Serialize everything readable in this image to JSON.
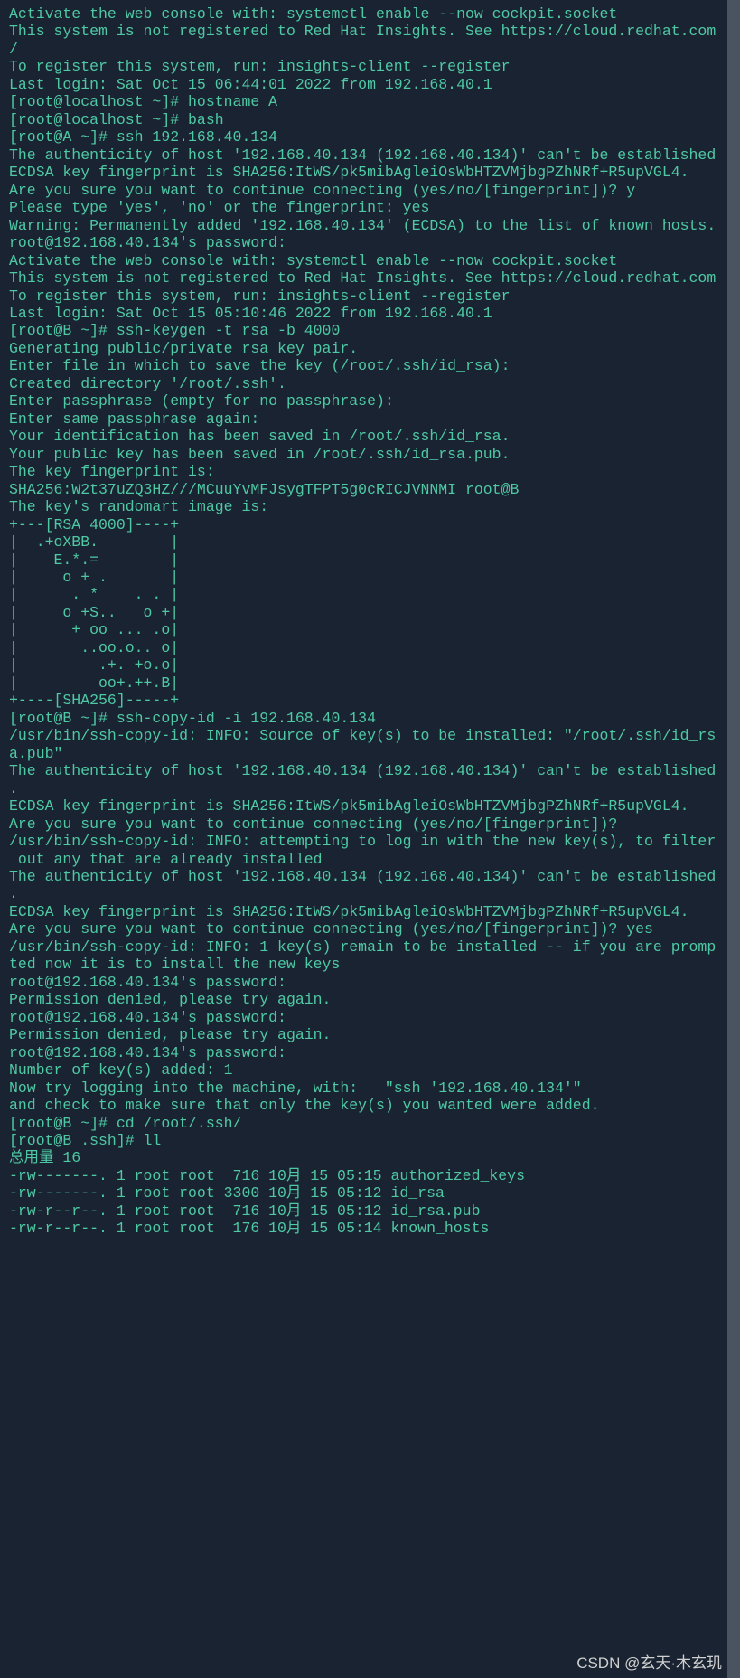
{
  "lines": [
    "Activate the web console with: systemctl enable --now cockpit.socket",
    "",
    "This system is not registered to Red Hat Insights. See https://cloud.redhat.com",
    "/",
    "To register this system, run: insights-client --register",
    "",
    "Last login: Sat Oct 15 06:44:01 2022 from 192.168.40.1",
    "[root@localhost ~]# hostname A",
    "[root@localhost ~]# bash",
    "[root@A ~]# ssh 192.168.40.134",
    "The authenticity of host '192.168.40.134 (192.168.40.134)' can't be established",
    "ECDSA key fingerprint is SHA256:ItWS/pk5mibAgleiOsWbHTZVMjbgPZhNRf+R5upVGL4.",
    "Are you sure you want to continue connecting (yes/no/[fingerprint])? y",
    "Please type 'yes', 'no' or the fingerprint: yes",
    "Warning: Permanently added '192.168.40.134' (ECDSA) to the list of known hosts.",
    "root@192.168.40.134's password:",
    "Activate the web console with: systemctl enable --now cockpit.socket",
    "",
    "This system is not registered to Red Hat Insights. See https://cloud.redhat.com",
    "To register this system, run: insights-client --register",
    "",
    "Last login: Sat Oct 15 05:10:46 2022 from 192.168.40.1",
    "[root@B ~]# ssh-keygen -t rsa -b 4000",
    "Generating public/private rsa key pair.",
    "Enter file in which to save the key (/root/.ssh/id_rsa):",
    "Created directory '/root/.ssh'.",
    "Enter passphrase (empty for no passphrase):",
    "Enter same passphrase again:",
    "Your identification has been saved in /root/.ssh/id_rsa.",
    "Your public key has been saved in /root/.ssh/id_rsa.pub.",
    "The key fingerprint is:",
    "SHA256:W2t37uZQ3HZ///MCuuYvMFJsygTFPT5g0cRICJVNNMI root@B",
    "The key's randomart image is:",
    "+---[RSA 4000]----+",
    "|  .+oXBB.        |",
    "|    E.*.=        |",
    "|     o + .       |",
    "|      . *    . . |",
    "|     o +S..   o +|",
    "|      + oo ... .o|",
    "|       ..oo.o.. o|",
    "|         .+. +o.o|",
    "|         oo+.++.B|",
    "+----[SHA256]-----+",
    "[root@B ~]# ssh-copy-id -i 192.168.40.134",
    "/usr/bin/ssh-copy-id: INFO: Source of key(s) to be installed: \"/root/.ssh/id_rs",
    "a.pub\"",
    "The authenticity of host '192.168.40.134 (192.168.40.134)' can't be established",
    ".",
    "ECDSA key fingerprint is SHA256:ItWS/pk5mibAgleiOsWbHTZVMjbgPZhNRf+R5upVGL4.",
    "Are you sure you want to continue connecting (yes/no/[fingerprint])?",
    "/usr/bin/ssh-copy-id: INFO: attempting to log in with the new key(s), to filter",
    " out any that are already installed",
    "The authenticity of host '192.168.40.134 (192.168.40.134)' can't be established",
    ".",
    "ECDSA key fingerprint is SHA256:ItWS/pk5mibAgleiOsWbHTZVMjbgPZhNRf+R5upVGL4.",
    "Are you sure you want to continue connecting (yes/no/[fingerprint])? yes",
    "/usr/bin/ssh-copy-id: INFO: 1 key(s) remain to be installed -- if you are promp",
    "ted now it is to install the new keys",
    "root@192.168.40.134's password:",
    "",
    "",
    "",
    "Permission denied, please try again.",
    "root@192.168.40.134's password:",
    "Permission denied, please try again.",
    "root@192.168.40.134's password:",
    "",
    "Number of key(s) added: 1",
    "",
    "Now try logging into the machine, with:   \"ssh '192.168.40.134'\"",
    "and check to make sure that only the key(s) you wanted were added.",
    "",
    "[root@B ~]# cd /root/.ssh/",
    "[root@B .ssh]# ll",
    "总用量 16",
    "-rw-------. 1 root root  716 10月 15 05:15 authorized_keys",
    "-rw-------. 1 root root 3300 10月 15 05:12 id_rsa",
    "-rw-r--r--. 1 root root  716 10月 15 05:12 id_rsa.pub",
    "-rw-r--r--. 1 root root  176 10月 15 05:14 known_hosts"
  ],
  "watermark": "CSDN @玄天·木玄玑"
}
